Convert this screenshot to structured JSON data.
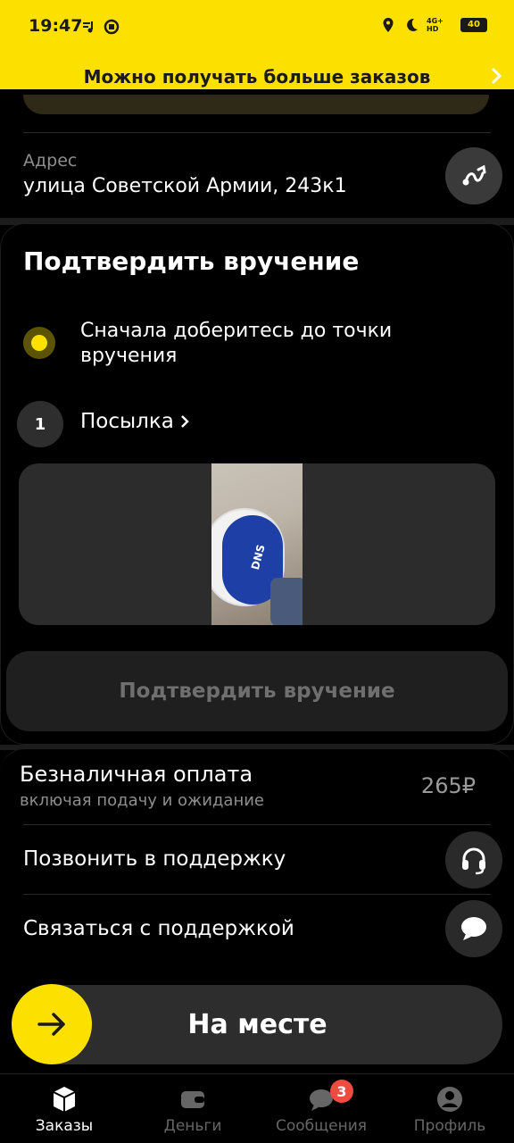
{
  "status_bar": {
    "time": "19:47",
    "network": "4G+ HD",
    "battery": "40"
  },
  "banner": {
    "text": "Можно получать больше заказов"
  },
  "address": {
    "label": "Адрес",
    "value": "улица Советской Армии, 243к1"
  },
  "confirm": {
    "title": "Подтвердить вручение",
    "step_text": "Сначала доберитесь до точки вручения",
    "item_number": "1",
    "item_label": "Посылка",
    "photo_text": "DNS",
    "button_label": "Подтвердить вручение"
  },
  "payment": {
    "title": "Безналичная оплата",
    "subtitle": "включая подачу и ожидание",
    "amount": "265₽"
  },
  "support": {
    "call_label": "Позвонить в поддержку",
    "chat_label": "Связаться с поддержкой"
  },
  "slide_action": {
    "label": "На месте"
  },
  "nav": {
    "orders": "Заказы",
    "money": "Деньги",
    "messages": "Сообщения",
    "messages_badge": "3",
    "profile": "Профиль"
  },
  "colors": {
    "accent": "#fce000",
    "background": "#000000",
    "badge": "#f04b3e"
  }
}
